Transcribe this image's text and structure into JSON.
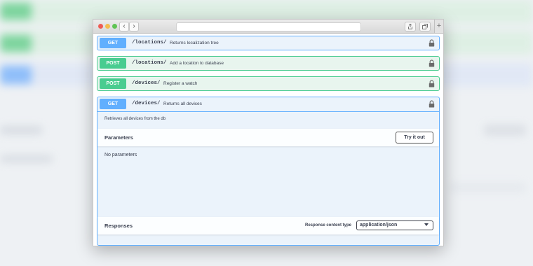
{
  "colors": {
    "get": "#61affe",
    "post": "#49cc90",
    "get_bg": "#ebf3fb",
    "post_bg": "#e8f5ee",
    "text": "#3b4151"
  },
  "browser": {
    "back_icon": "chevron-left-icon",
    "forward_icon": "chevron-right-icon",
    "share_icon": "share-icon",
    "tabs_icon": "tabs-icon",
    "new_tab_icon": "plus-icon"
  },
  "operations": [
    {
      "method": "GET",
      "path": "/locations/",
      "summary": "Returns localization tree",
      "icon": "lock-icon"
    },
    {
      "method": "POST",
      "path": "/locations/",
      "summary": "Add a location to database",
      "icon": "lock-icon"
    },
    {
      "method": "POST",
      "path": "/devices/",
      "summary": "Register a watch",
      "icon": "lock-icon"
    }
  ],
  "expanded": {
    "method": "GET",
    "path": "/devices/",
    "summary": "Returns all devices",
    "description": "Retrieves all devices from the db",
    "icon": "lock-icon",
    "parameters_title": "Parameters",
    "try_button": "Try it out",
    "no_parameters": "No parameters",
    "responses_title": "Responses",
    "response_content_type_label": "Response content type",
    "response_content_type_value": "application/json"
  }
}
